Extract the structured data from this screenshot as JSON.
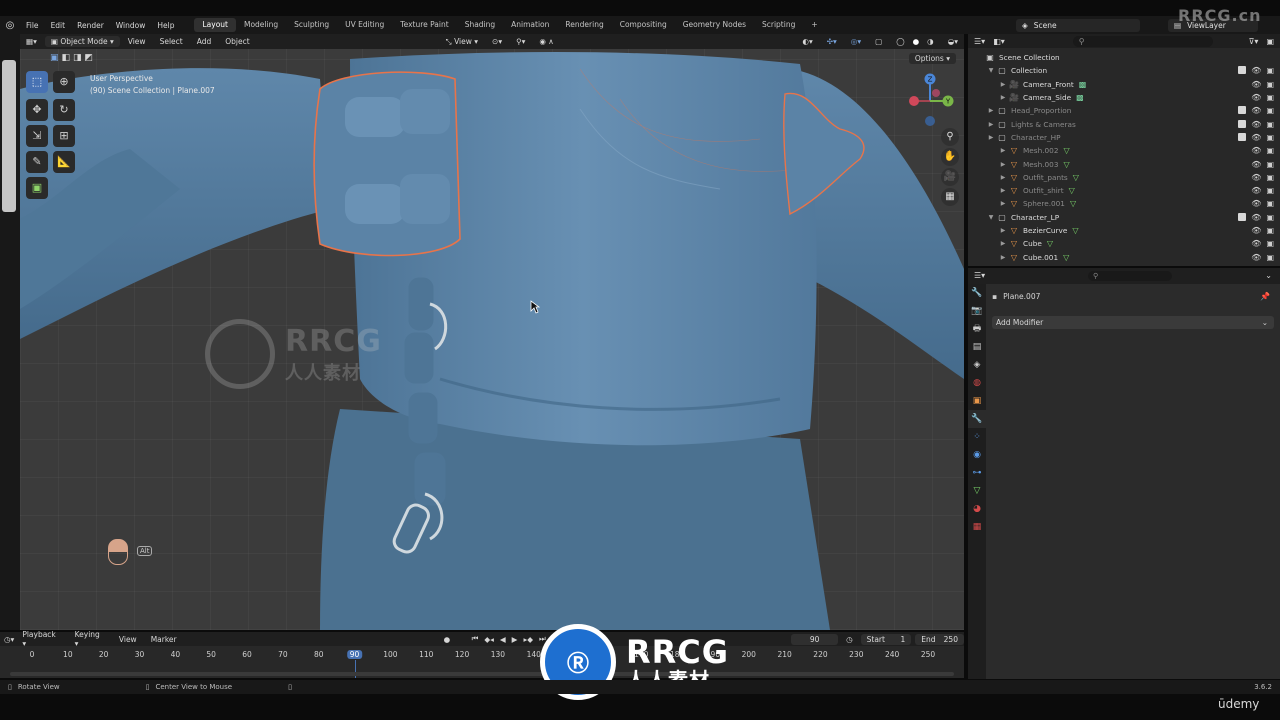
{
  "top_menu": {
    "items": [
      "File",
      "Edit",
      "Render",
      "Window",
      "Help"
    ],
    "workspaces": [
      "Layout",
      "Modeling",
      "Sculpting",
      "UV Editing",
      "Texture Paint",
      "Shading",
      "Animation",
      "Rendering",
      "Compositing",
      "Geometry Nodes",
      "Scripting"
    ],
    "active_workspace": "Layout",
    "add_tab": "+",
    "scene": "Scene",
    "view_layer": "ViewLayer"
  },
  "viewport_header": {
    "mode": "Object Mode",
    "menus": [
      "View",
      "Select",
      "Add",
      "Object"
    ],
    "transform_orientation": "View"
  },
  "viewport": {
    "perspective": "User Perspective",
    "collection_info": "(90) Scene Collection | Plane.007",
    "options": "Options",
    "gizmo_axes": [
      "X",
      "Y",
      "Z"
    ],
    "alt_hint": "Alt"
  },
  "outliner": {
    "search_placeholder": "",
    "rows": [
      {
        "label": "Scene Collection",
        "level": 0,
        "icon": "scene-collection-icon",
        "dim": false
      },
      {
        "label": "Collection",
        "level": 1,
        "icon": "collection-icon",
        "dim": false
      },
      {
        "label": "Camera_Front",
        "level": 2,
        "icon": "camera-icon",
        "dim": false
      },
      {
        "label": "Camera_Side",
        "level": 2,
        "icon": "camera-icon",
        "dim": false
      },
      {
        "label": "Head_Proportion",
        "level": 1,
        "icon": "collection-icon",
        "dim": true
      },
      {
        "label": "Lights & Cameras",
        "level": 1,
        "icon": "collection-icon",
        "dim": true
      },
      {
        "label": "Character_HP",
        "level": 1,
        "icon": "collection-icon",
        "dim": true
      },
      {
        "label": "Mesh.002",
        "level": 2,
        "icon": "mesh-icon",
        "dim": true
      },
      {
        "label": "Mesh.003",
        "level": 2,
        "icon": "mesh-icon",
        "dim": true
      },
      {
        "label": "Outfit_pants",
        "level": 2,
        "icon": "mesh-icon",
        "dim": true
      },
      {
        "label": "Outfit_shirt",
        "level": 2,
        "icon": "mesh-icon",
        "dim": true
      },
      {
        "label": "Sphere.001",
        "level": 2,
        "icon": "mesh-icon",
        "dim": true
      },
      {
        "label": "Character_LP",
        "level": 1,
        "icon": "collection-icon",
        "dim": false
      },
      {
        "label": "BezierCurve",
        "level": 2,
        "icon": "curve-icon",
        "dim": false
      },
      {
        "label": "Cube",
        "level": 2,
        "icon": "mesh-icon",
        "dim": false
      },
      {
        "label": "Cube.001",
        "level": 2,
        "icon": "mesh-icon",
        "dim": false
      }
    ]
  },
  "properties": {
    "object_name": "Plane.007",
    "add_modifier": "Add Modifier"
  },
  "timeline": {
    "menus": [
      "Playback",
      "Keying",
      "View",
      "Marker"
    ],
    "current_frame": "90",
    "start_label": "Start",
    "start_value": "1",
    "end_label": "End",
    "end_value": "250",
    "ticks": [
      "0",
      "10",
      "20",
      "30",
      "40",
      "50",
      "60",
      "70",
      "80",
      "90",
      "100",
      "110",
      "120",
      "130",
      "140",
      "150",
      "160",
      "170",
      "180",
      "190",
      "200",
      "210",
      "220",
      "230",
      "240",
      "250"
    ]
  },
  "status_bar": {
    "left_hint": "Rotate View",
    "middle_hint": "Center View to Mouse",
    "version": "3.6.2"
  },
  "watermarks": {
    "brand": "RRCG",
    "brand_cn": "人人素材",
    "corner": "RRCG.cn",
    "udemy": "ūdemy"
  },
  "colors": {
    "accent": "#4772b3",
    "selection_outline": "#e8744a",
    "mesh": "#5f86a8",
    "udemy_purple": "#a435f0"
  }
}
